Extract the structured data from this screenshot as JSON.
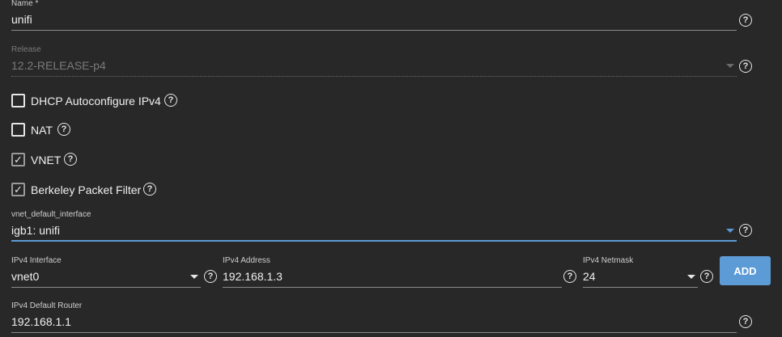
{
  "name": {
    "label": "Name *",
    "value": "unifi"
  },
  "release": {
    "label": "Release",
    "value": "12.2-RELEASE-p4"
  },
  "checkboxes": [
    {
      "label": "DHCP Autoconfigure IPv4",
      "checked": false
    },
    {
      "label": "NAT",
      "checked": false
    },
    {
      "label": "VNET",
      "checked": true
    },
    {
      "label": "Berkeley Packet Filter",
      "checked": true
    }
  ],
  "vnet_default_interface": {
    "label": "vnet_default_interface",
    "value": "igb1: unifi"
  },
  "ipv4_interface": {
    "label": "IPv4 Interface",
    "value": "vnet0"
  },
  "ipv4_address": {
    "label": "IPv4 Address",
    "value": "192.168.1.3"
  },
  "ipv4_netmask": {
    "label": "IPv4 Netmask",
    "value": "24"
  },
  "add_button": {
    "label": "ADD"
  },
  "ipv4_default_router": {
    "label": "IPv4 Default Router",
    "value": "192.168.1.1"
  },
  "help_glyph": "?",
  "check_glyph": "✓",
  "colors": {
    "accent": "#5c9bd6",
    "background": "#282828",
    "text": "#f0f0f0"
  }
}
